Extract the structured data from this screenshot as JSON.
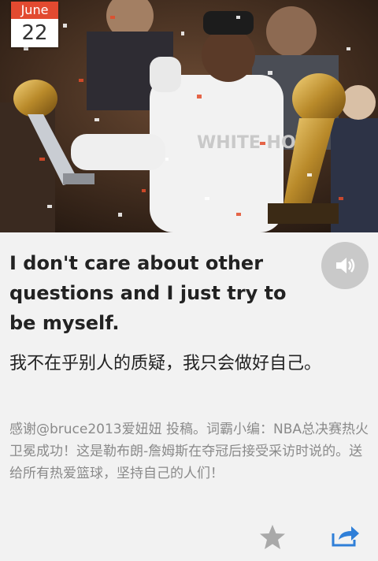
{
  "date": {
    "month": "June",
    "day": "22"
  },
  "hero": {
    "image": "basketball-player-celebrating-with-trophies-photo",
    "shirt_text": "WHITE HOT"
  },
  "english_sentence": "I don't care about other questions and I just try to be myself.",
  "chinese_sentence": "我不在乎别人的质疑，我只会做好自己。",
  "note": "感谢@bruce2013爱妞妞 投稿。词霸小编：NBA总决赛热火卫冕成功！这是勒布朗-詹姆斯在夺冠后接受采访时说的。送给所有热爱篮球，坚持自己的人们！",
  "icons": {
    "speaker": "speaker-icon",
    "favorite": "star-icon",
    "share": "share-icon"
  },
  "colors": {
    "month_badge": "#e24a30",
    "share_icon": "#2f7fd8",
    "star_icon": "#a9a9a9",
    "speaker_bg": "#c9c9c9"
  }
}
